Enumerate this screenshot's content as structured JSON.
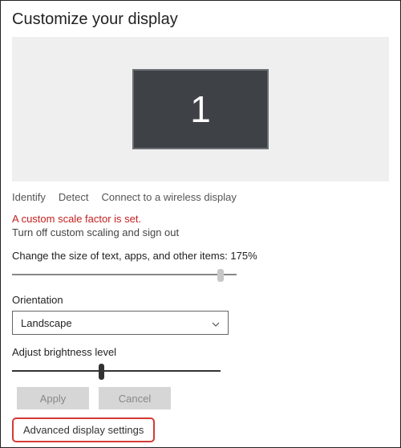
{
  "title": "Customize your display",
  "monitor_number": "1",
  "links": {
    "identify": "Identify",
    "detect": "Detect",
    "wireless": "Connect to a wireless display"
  },
  "warning_text": "A custom scale factor is set.",
  "turnoff_text": "Turn off custom scaling and sign out",
  "scale_label": "Change the size of text, apps, and other items: 175%",
  "orientation_label": "Orientation",
  "orientation_value": "Landscape",
  "brightness_label": "Adjust brightness level",
  "buttons": {
    "apply": "Apply",
    "cancel": "Cancel"
  },
  "advanced_link": "Advanced display settings"
}
